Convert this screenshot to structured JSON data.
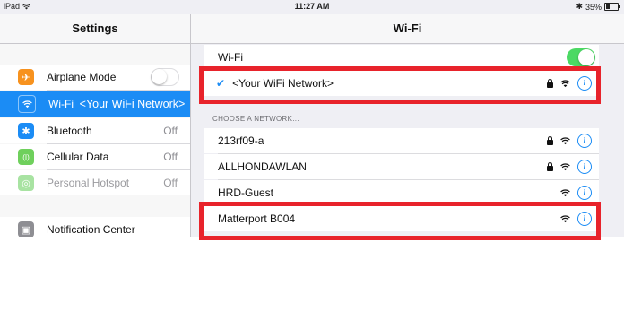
{
  "status_bar": {
    "device": "iPad",
    "time": "11:27 AM",
    "battery_percent": "35%",
    "battery_level": 0.35,
    "bluetooth_glyph": "✱"
  },
  "sidebar": {
    "title": "Settings",
    "items": [
      {
        "label": "Airplane Mode",
        "value": "",
        "icon": "airplane-icon",
        "color": "#f7921e",
        "glyph": "✈",
        "toggle": "off"
      },
      {
        "label": "Wi-Fi",
        "value": "<Your WiFi Network>",
        "icon": "wifi-icon",
        "color": "#1b8cf5",
        "selected": true
      },
      {
        "label": "Bluetooth",
        "value": "Off",
        "icon": "bluetooth-icon",
        "color": "#1b8cf5",
        "glyph": "✱"
      },
      {
        "label": "Cellular Data",
        "value": "Off",
        "icon": "cellular-icon",
        "color": "#6fd05c",
        "glyph": "(I)"
      },
      {
        "label": "Personal Hotspot",
        "value": "Off",
        "icon": "hotspot-icon",
        "color": "#a8e3a2",
        "glyph": "◎",
        "dimmed": true
      },
      {
        "label": "Notification Center",
        "value": "",
        "icon": "notification-center-icon",
        "color": "#8e8e93",
        "glyph": "▣"
      }
    ]
  },
  "main": {
    "title": "Wi-Fi",
    "wifi_toggle_label": "Wi-Fi",
    "wifi_toggle_state": "on",
    "connected_network": "<Your WiFi Network>",
    "check_glyph": "✔",
    "section_label": "CHOOSE A NETWORK...",
    "networks": [
      {
        "name": "213rf09-a",
        "locked": true
      },
      {
        "name": "ALLHONDAWLAN",
        "locked": true
      },
      {
        "name": "HRD-Guest",
        "locked": false
      },
      {
        "name": "Matterport B004",
        "locked": false
      }
    ],
    "info_glyph": "i"
  },
  "colors": {
    "accent": "#1b8cf5",
    "toggle_on": "#4cd964",
    "highlight": "#e8232b"
  }
}
